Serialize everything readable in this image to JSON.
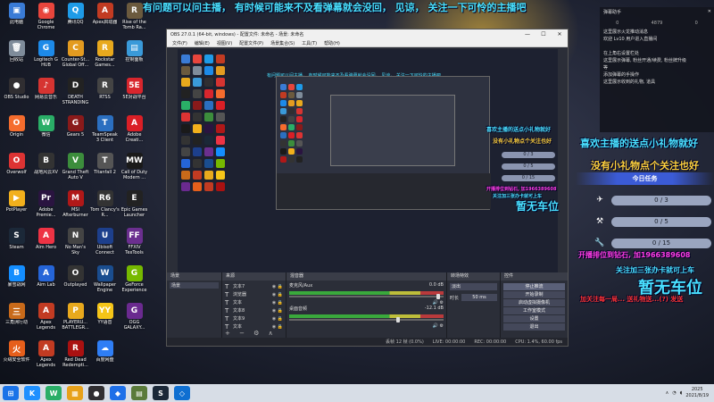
{
  "overlay": {
    "marquee": "有问题可以问主播， 有时候可能来不及看弹幕就会没回， 见谅， 关注一下可怜的主播吧",
    "thanks_gift": "喜欢主播的送点小礼物就好",
    "thanks_follow": "没有小礼物点个关注也好",
    "task_title": "今日任务",
    "tasks": [
      {
        "icon": "plane-icon",
        "value": "0 / 3"
      },
      {
        "icon": "hammer-icon",
        "value": "0 / 5"
      },
      {
        "icon": "wrench-icon",
        "value": "0 / 15"
      }
    ],
    "rank_text": "开播排位到钻石, 加1966389608",
    "follow_hint": "关注加三张办卡就可上车",
    "no_seat": "暂无车位",
    "seat_small": "暂无车位",
    "small_thanks_1": "喜欢主播的送点小礼物就好",
    "small_thanks_2": "没有小礼物点个关注也好",
    "small_rank": "开播排位到钻石, 加1966389608",
    "small_follow": "关注加三张办卡就可上车",
    "bottom_scroll": "加关注每一局... 送礼物送...(?) 发送",
    "mini_bars": [
      "0 / 3",
      "0 / 5",
      "0 / 15"
    ]
  },
  "desktop_icons": [
    {
      "label": "此电脑",
      "color": "#3a7bd5",
      "glyph": "▣"
    },
    {
      "label": "Google Chrome",
      "color": "#e8453c",
      "glyph": "◉"
    },
    {
      "label": "腾讯QQ",
      "color": "#1e9be8",
      "glyph": "Q"
    },
    {
      "label": "Apex启动器",
      "color": "#c23b22",
      "glyph": "A"
    },
    {
      "label": "Rise of the Tomb Ra...",
      "color": "#6b5a3e",
      "glyph": "R"
    },
    {
      "label": "回收站",
      "color": "#7f8c9a",
      "glyph": "🗑"
    },
    {
      "label": "Logitech G HUB",
      "color": "#1d8ae8",
      "glyph": "G"
    },
    {
      "label": "Counter-St... Global Off...",
      "color": "#e39b20",
      "glyph": "C"
    },
    {
      "label": "Rockstar Games...",
      "color": "#e8a91d",
      "glyph": "R"
    },
    {
      "label": "控制面板",
      "color": "#3a9ad9",
      "glyph": "▤"
    },
    {
      "label": "OBS Studio",
      "color": "#302e31",
      "glyph": "●"
    },
    {
      "label": "网易云音乐",
      "color": "#d63431",
      "glyph": "♪"
    },
    {
      "label": "DEATH STRANDING",
      "color": "#222",
      "glyph": "D"
    },
    {
      "label": "RTSS",
      "color": "#444",
      "glyph": "R"
    },
    {
      "label": "5E对战平台",
      "color": "#d8262d",
      "glyph": "5E"
    },
    {
      "label": "Origin",
      "color": "#f56c2d",
      "glyph": "O"
    },
    {
      "label": "微信",
      "color": "#2aae67",
      "glyph": "W"
    },
    {
      "label": "Gears 5",
      "color": "#8a1a1a",
      "glyph": "G"
    },
    {
      "label": "TeamSpeak 3 Client",
      "color": "#2b6fc0",
      "glyph": "T"
    },
    {
      "label": "Adobe Creati...",
      "color": "#da1f26",
      "glyph": "A"
    },
    {
      "label": "Overwolf",
      "color": "#d33",
      "glyph": "O"
    },
    {
      "label": "战地风云XV",
      "color": "#333",
      "glyph": "B"
    },
    {
      "label": "Grand Theft Auto V",
      "color": "#3c8d3c",
      "glyph": "V"
    },
    {
      "label": "Titanfall 2",
      "color": "#555",
      "glyph": "T"
    },
    {
      "label": "Call of Duty Modern ...",
      "color": "#1a1a1a",
      "glyph": "MW"
    },
    {
      "label": "PotPlayer",
      "color": "#f2b01c",
      "glyph": "▶"
    },
    {
      "label": "Adobe Premie...",
      "color": "#2a1440",
      "glyph": "Pr"
    },
    {
      "label": "MSI Afterburner",
      "color": "#b01818",
      "glyph": "M"
    },
    {
      "label": "Tom Clancy's R...",
      "color": "#333",
      "glyph": "R6"
    },
    {
      "label": "Epic Games Launcher",
      "color": "#222",
      "glyph": "E"
    },
    {
      "label": "Steam",
      "color": "#1b2838",
      "glyph": "S"
    },
    {
      "label": "Aim Hero",
      "color": "#e34",
      "glyph": "A"
    },
    {
      "label": "No Man's Sky",
      "color": "#444",
      "glyph": "N"
    },
    {
      "label": "Ubisoft Connect",
      "color": "#1d3f8c",
      "glyph": "U"
    },
    {
      "label": "FFXIV TexTools",
      "color": "#6b2f8f",
      "glyph": "FF"
    },
    {
      "label": "暴雪战网",
      "color": "#148eff",
      "glyph": "B"
    },
    {
      "label": "Aim Lab",
      "color": "#2565d8",
      "glyph": "A"
    },
    {
      "label": "Outplayed",
      "color": "#333",
      "glyph": "O"
    },
    {
      "label": "Wallpaper Engine",
      "color": "#1a4d8f",
      "glyph": "W"
    },
    {
      "label": "GeForce Experience",
      "color": "#76b900",
      "glyph": "G"
    },
    {
      "label": "三角洲行动",
      "color": "#c86a1a",
      "glyph": "三"
    },
    {
      "label": "Apex Legends",
      "color": "#c23b22",
      "glyph": "A"
    },
    {
      "label": "PLAYERU... BATTLEGR...",
      "color": "#e8a91d",
      "glyph": "P"
    },
    {
      "label": "YY语音",
      "color": "#f5c518",
      "glyph": "YY"
    },
    {
      "label": "OGG GALAXY...",
      "color": "#6a2a8f",
      "glyph": "G"
    },
    {
      "label": "火绒安全软件",
      "color": "#e65f1b",
      "glyph": "火"
    },
    {
      "label": "Apex Legends",
      "color": "#c23b22",
      "glyph": "A"
    },
    {
      "label": "Red Dead Redempti...",
      "color": "#a11",
      "glyph": "R"
    },
    {
      "label": "百度网盘",
      "color": "#2f7ef5",
      "glyph": "☁"
    }
  ],
  "obs": {
    "title": "OBS 27.0.1 (64-bit, windows) - 配置文件: 未命名 - 场景: 未命名",
    "menu": [
      "文件(F)",
      "编辑(E)",
      "视图(V)",
      "配置文件(P)",
      "场景集合(S)",
      "工具(T)",
      "帮助(H)"
    ],
    "preview_marquee": "有问题可以问主播， 有时候可能来不及看弹幕就会没回， 见谅， 关注一下可怜的主播吧",
    "docks": {
      "scenes_header": "场景",
      "scene_items": [
        "场景"
      ],
      "sources_header": "来源",
      "sources": [
        {
          "icon": "T",
          "name": "文本7"
        },
        {
          "icon": "T",
          "name": "浏览器"
        },
        {
          "icon": "T",
          "name": "文本"
        },
        {
          "icon": "T",
          "name": "文本8"
        },
        {
          "icon": "T",
          "name": "文本9"
        },
        {
          "icon": "T",
          "name": "文本"
        }
      ],
      "mixer_header": "混音器",
      "mixer": [
        {
          "name": "麦克风/Aux",
          "level": "0.0 dB"
        },
        {
          "name": "桌面音频",
          "level": "-12.1 dB"
        }
      ],
      "transitions_header": "转场特效",
      "transition_type": "淡出",
      "duration_label": "时长",
      "duration_value": "50 ms",
      "controls_header": "控件",
      "controls": [
        "停止推流",
        "开始录制",
        "启动虚拟摄像机",
        "工作室模式",
        "设置",
        "退出"
      ]
    },
    "status": {
      "dropped": "丢帧 12 帧 (0.0%)",
      "live": "LIVE: 00:00:00",
      "rec": "REC: 00:00:00",
      "cpu": "CPU: 1.4%, 60.00 fps"
    }
  },
  "chat": {
    "title": "弹幕助手",
    "stats": [
      "0",
      "4879",
      "0"
    ],
    "lines": [
      "这里展示火龙推动消息",
      "欢迎 Lv10 用户进入直播间",
      "",
      "在上角右设置栏处",
      "这里展示弹幕, 粉丝开通/续费, 粉丝牌升级",
      "等",
      "添加弹幕的手操作",
      "这里展示收到的礼物, 道具"
    ]
  },
  "taskbar": {
    "apps": [
      {
        "name": "windows-icon",
        "color": "#1a73e8",
        "glyph": "⊞"
      },
      {
        "name": "kook-icon",
        "color": "#1e90ff",
        "glyph": "K"
      },
      {
        "name": "wechat-icon",
        "color": "#2aae67",
        "glyph": "W"
      },
      {
        "name": "explorer-icon",
        "color": "#e7a11a",
        "glyph": "▦"
      },
      {
        "name": "obs-icon",
        "color": "#302e31",
        "glyph": "●"
      },
      {
        "name": "app-icon",
        "color": "#1d6fe8",
        "glyph": "◆"
      },
      {
        "name": "game-icon",
        "color": "#5a7a3a",
        "glyph": "▤"
      },
      {
        "name": "steam-icon",
        "color": "#1b2838",
        "glyph": "S"
      },
      {
        "name": "store-icon",
        "color": "#0f6fd1",
        "glyph": "◇"
      }
    ],
    "time": "2025",
    "date": "2021/8/19"
  },
  "colors": {
    "accent": "#49e0ff",
    "gold": "#ffd23c",
    "magenta": "#ff3ce6",
    "red": "#ff3333"
  }
}
